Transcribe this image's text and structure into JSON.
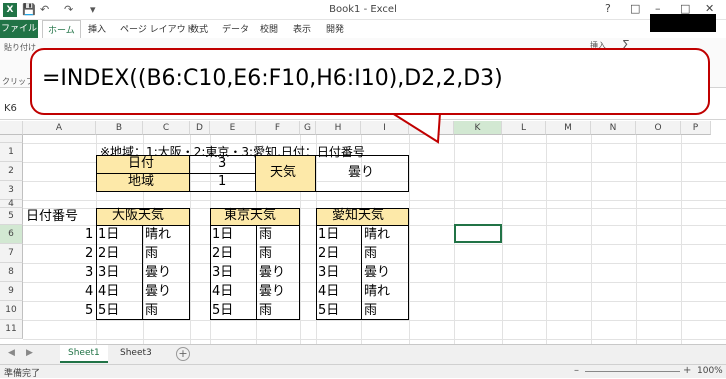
{
  "window": {
    "title": "Book1 - Excel"
  },
  "ribbon_tabs": [
    "ファイル",
    "ホーム",
    "挿入",
    "ページ レイアウト",
    "数式",
    "データ",
    "校閲",
    "表示",
    "開発"
  ],
  "ribbon_partial_labels": {
    "paste": "貼り付け",
    "clipboard": "クリップボード",
    "insert": "挿入",
    "sigma": "Σ"
  },
  "formula_callout": "=INDEX((B6:C10,E6:F10,H6:I10),D2,2,D3)",
  "name_box": "K6",
  "columns": [
    "A",
    "B",
    "C",
    "D",
    "E",
    "F",
    "G",
    "H",
    "I",
    "J",
    "K",
    "L",
    "M",
    "N",
    "O",
    "P"
  ],
  "rows": [
    "1",
    "2",
    "3",
    "4",
    "5",
    "6",
    "7",
    "8",
    "9",
    "10",
    "11"
  ],
  "sheet": {
    "note": "※地域：1:大阪・2:東京・3:愛知,日付：日付番号",
    "date_label": "日付",
    "date_value": "3",
    "region_label": "地域",
    "region_value": "1",
    "weather_label": "天気",
    "weather_result": "曇り",
    "date_number_label": "日付番号",
    "numbers": [
      "1",
      "2",
      "3",
      "4",
      "5"
    ],
    "tables": [
      {
        "title": "大阪天気",
        "days": [
          "1日",
          "2日",
          "3日",
          "4日",
          "5日"
        ],
        "weather": [
          "晴れ",
          "雨",
          "曇り",
          "曇り",
          "雨"
        ]
      },
      {
        "title": "東京天気",
        "days": [
          "1日",
          "2日",
          "3日",
          "4日",
          "5日"
        ],
        "weather": [
          "雨",
          "雨",
          "曇り",
          "曇り",
          "雨"
        ]
      },
      {
        "title": "愛知天気",
        "days": [
          "1日",
          "2日",
          "3日",
          "4日",
          "5日"
        ],
        "weather": [
          "晴れ",
          "雨",
          "曇り",
          "晴れ",
          "雨"
        ]
      }
    ]
  },
  "sheet_tabs": [
    "Sheet1",
    "Sheet3"
  ],
  "status": {
    "ready": "準備完了",
    "zoom": "100%"
  },
  "colors": {
    "excel_green": "#217346",
    "callout_border": "#c00000",
    "header_fill": "#fde9a9"
  }
}
